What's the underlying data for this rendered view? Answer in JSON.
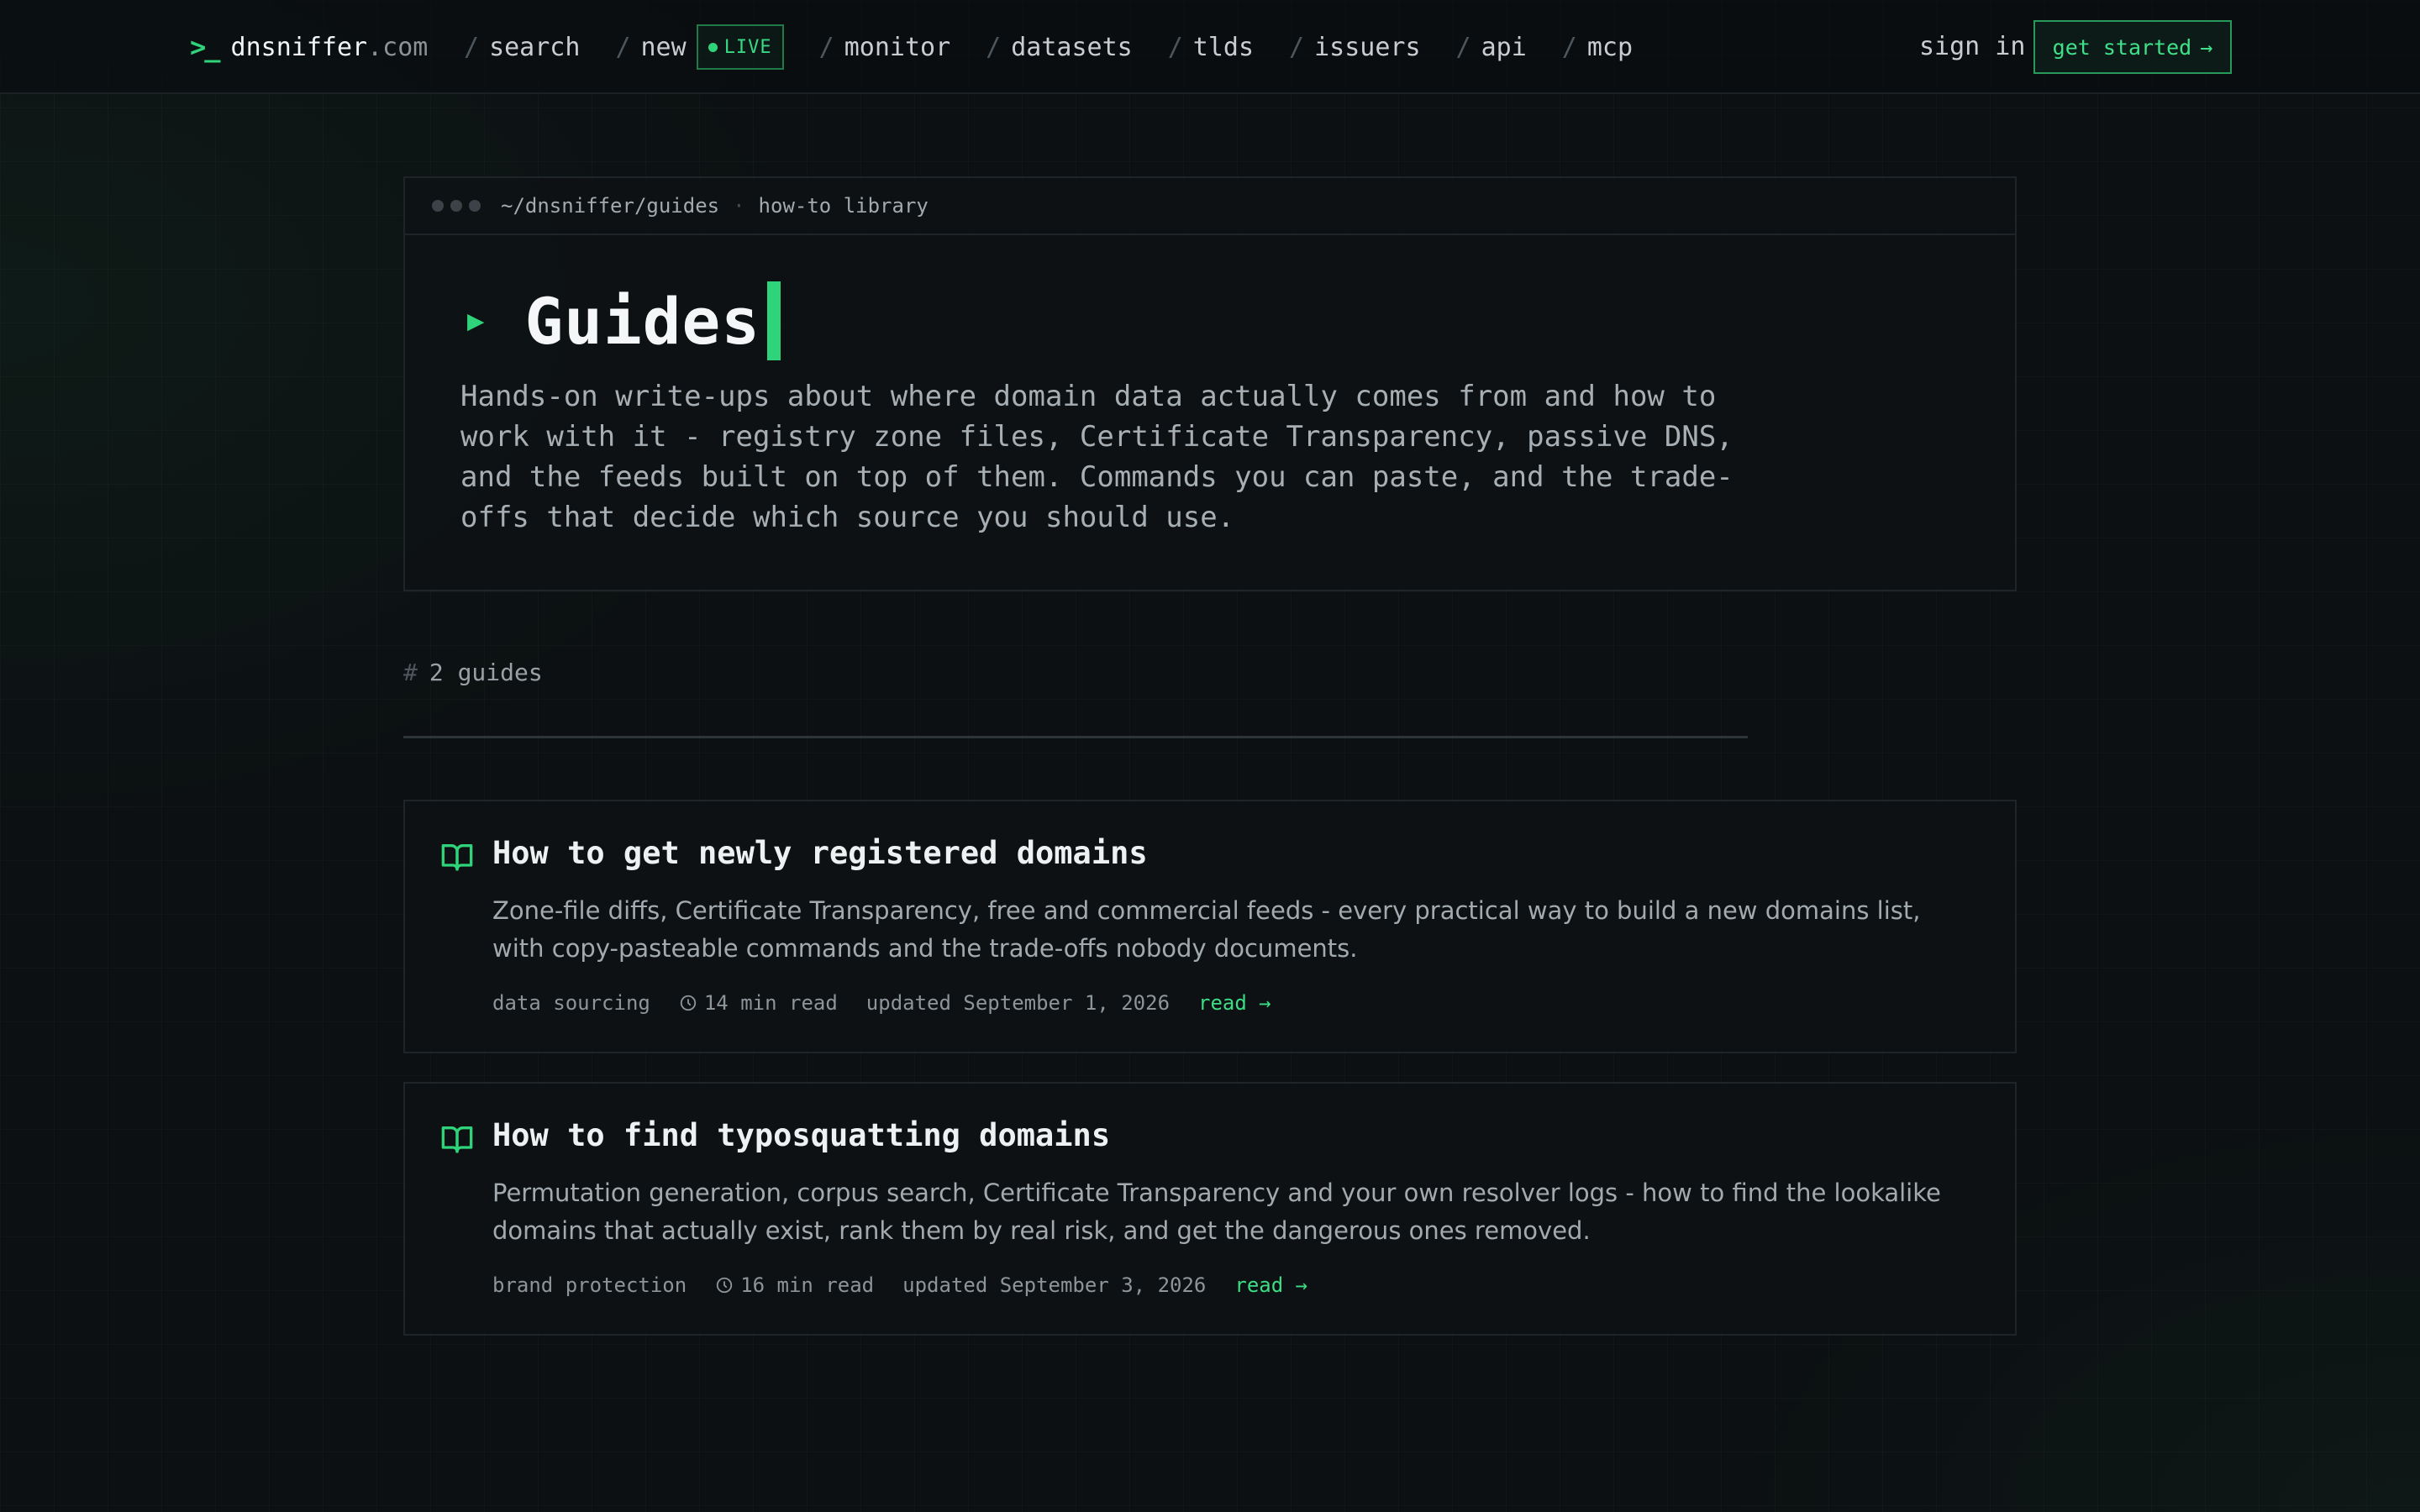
{
  "brand": {
    "prompt": ">_",
    "name": "dnsniffer",
    "tld": ".com"
  },
  "nav": {
    "items": [
      {
        "label": "search"
      },
      {
        "label": "new"
      },
      {
        "label": "monitor"
      },
      {
        "label": "datasets"
      },
      {
        "label": "tlds"
      },
      {
        "label": "issuers"
      },
      {
        "label": "api"
      },
      {
        "label": "mcp"
      }
    ],
    "live_badge": "LIVE",
    "signin": "sign in",
    "get_started": "get started",
    "get_started_arrow": "→"
  },
  "hero": {
    "path": "~/dnsniffer/guides",
    "separator": "·",
    "subtitle": "how-to library",
    "play_glyph": "▶",
    "title": "Guides",
    "description": "Hands-on write-ups about where domain data actually comes from and how to work with it - registry zone files, Certificate Transparency, passive DNS, and the feeds built on top of them. Commands you can paste, and the trade-offs that decide which source you should use."
  },
  "listing": {
    "hash": "#",
    "count_label": "2 guides"
  },
  "guides": [
    {
      "title": "How to get newly registered domains",
      "description": "Zone-file diffs, Certificate Transparency, free and commercial feeds - every practical way to build a new domains list, with copy-pasteable commands and the trade-offs nobody documents.",
      "category": "data sourcing",
      "read_time": "14 min read",
      "updated": "updated September 1, 2026",
      "link": "read →"
    },
    {
      "title": "How to find typosquatting domains",
      "description": "Permutation generation, corpus search, Certificate Transparency and your own resolver logs - how to find the lookalike domains that actually exist, rank them by real risk, and get the dangerous ones removed.",
      "category": "brand protection",
      "read_time": "16 min read",
      "updated": "updated September 3, 2026",
      "link": "read →"
    }
  ],
  "colors": {
    "accent": "#2fd37a",
    "background": "#0c1012",
    "panel_border": "#1e2428"
  }
}
